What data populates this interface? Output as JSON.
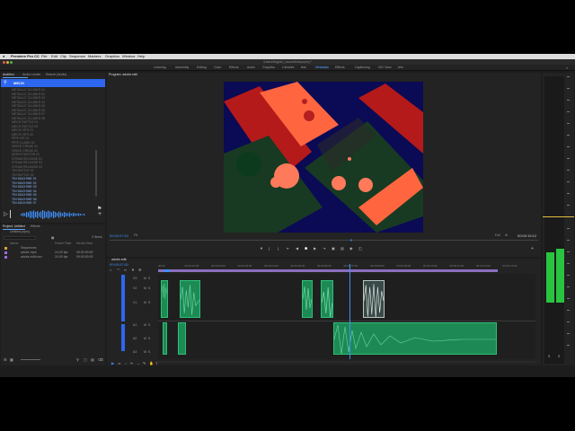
{
  "menubar": {
    "app": "Premiere Pro CC",
    "items": [
      "File",
      "Edit",
      "Clip",
      "Sequence",
      "Markers",
      "Graphics",
      "Window",
      "Help"
    ]
  },
  "window_title": "/Users/flaghb/_Launchfinal.prproj *",
  "workspaces": [
    "Learning",
    "Assembly",
    "Editing",
    "Color",
    "Effects",
    "Audio",
    "Graphics",
    "Libraries",
    "test",
    "Metadata",
    "Effects",
    "Captioning",
    "ISO View",
    "test"
  ],
  "active_workspace_index": 9,
  "source_panel": {
    "tabs": [
      "Audition",
      "Audio Levels",
      "Search (Audio)"
    ],
    "search_value": "MECH",
    "items": [
      "METALLIC CLUNKS 01",
      "METALLIC CLUNKS 02",
      "METALLIC CLUNKS 03",
      "METALLIC CLUNKS 04",
      "METALLIC CLUNKS 05",
      "METALLIC CLUNKS 06",
      "METALLIC CLUNKS 07",
      "METALLIC CLUNKS 08",
      "MECH RATTLE 01",
      "MECH RATTLE 02",
      "MECH HITS 01",
      "MECH HITS 02",
      "PIPE HIT 01",
      "PIPE CLANG 01",
      "HINGE CREAK 01",
      "HINGE CREAK 02",
      "SERVO MOTOR 01",
      "STEAM RELEASE 01",
      "STEAM RELEASE 02",
      "STEAM RELEASE 03",
      "TIN RATTLE 01",
      "TIN RATTLE 02",
      "TIN MACHINE 01",
      "TIN MACHINE 02",
      "TIN MACHINE 03",
      "TIN MACHINE 04",
      "TIN MACHINE 05",
      "TIN MACHINE 06",
      "TIN MACHINE 07"
    ]
  },
  "project_panel": {
    "tabs": [
      "Project: Untitled",
      "Effects"
    ],
    "project_name": "Untitled.prproj",
    "count": "3 Items",
    "columns": [
      "Name",
      "Frame Rate",
      "Media Start"
    ],
    "rows": [
      {
        "name": "Sequences",
        "rate": "",
        "start": "",
        "color": "#e0a040"
      },
      {
        "name": "adobe.mp4",
        "rate": "24.00 fps",
        "start": "00:00:00:00",
        "color": "#9a6be0"
      },
      {
        "name": "adobe-edit.mov",
        "rate": "24.00 fps",
        "start": "00:00:00:00",
        "color": "#9a6be0"
      }
    ]
  },
  "program_monitor": {
    "title": "Program: adobe.edit",
    "timecode": "00:00:07:01",
    "fit": "Fit",
    "resolution": "Full",
    "duration": "00:00:15:12"
  },
  "timeline": {
    "tab": "adobe.edit",
    "timecode": "00:00:07:01",
    "ruler": [
      "00:00",
      "00:00:01:00",
      "00:00:02:00",
      "00:00:03:00",
      "00:00:04:00",
      "00:00:05:00",
      "00:00:06:00",
      "00:00:07:00",
      "00:00:08:00",
      "00:00:09:00",
      "00:00:10:00",
      "00:00:11:00",
      "00:00:12:00",
      "00:00:13:00"
    ],
    "track_labels": [
      "V3",
      "V2",
      "V1",
      "A1",
      "A2",
      "A3"
    ]
  },
  "colors": {
    "accent_blue": "#2d67f0",
    "clip_green": "#1d8a55",
    "meter_green": "#28c440",
    "work_area": "#8a6fc0"
  }
}
